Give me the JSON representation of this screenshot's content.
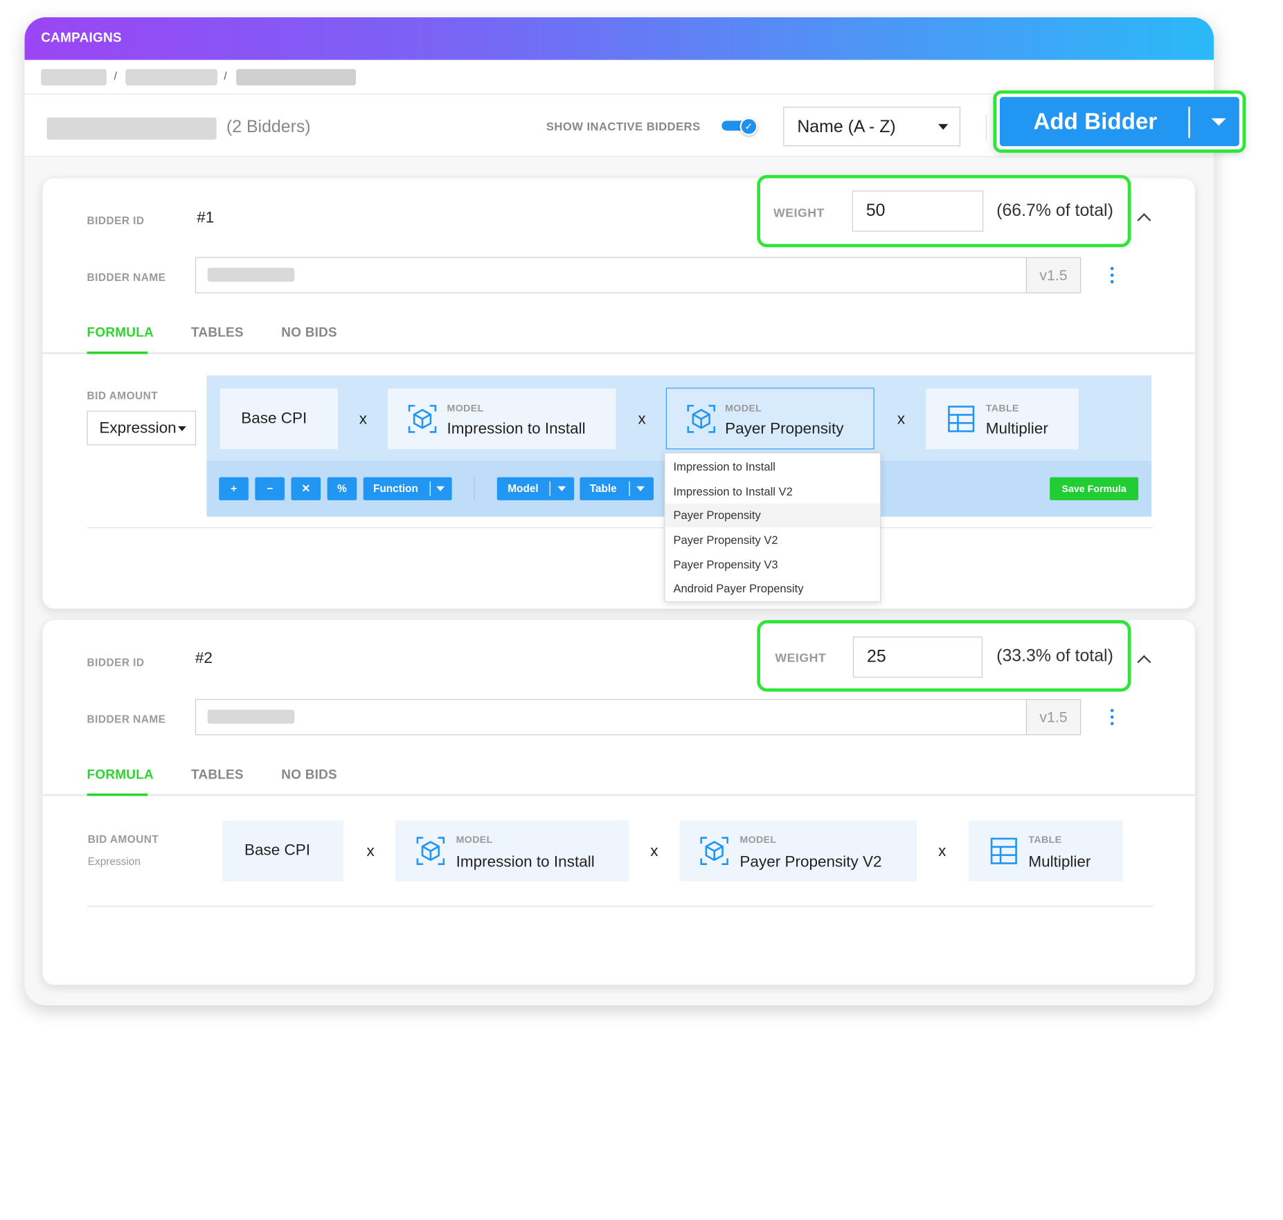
{
  "app": {
    "title": "CAMPAIGNS"
  },
  "header": {
    "bidders_count": "(2 Bidders)",
    "show_inactive_label": "SHOW INACTIVE BIDDERS",
    "show_inactive_on": true,
    "sort_value": "Name (A - Z)",
    "add_bidder_label": "Add Bidder"
  },
  "labels": {
    "bidder_id": "BIDDER ID",
    "bidder_name": "BIDDER NAME",
    "weight": "WEIGHT",
    "bid_amount": "BID AMOUNT",
    "model": "MODEL",
    "table": "TABLE",
    "x": "x"
  },
  "tabs": [
    "FORMULA",
    "TABLES",
    "NO BIDS"
  ],
  "bidders": [
    {
      "id": "#1",
      "weight": "50",
      "weight_pct": "(66.7% of total)",
      "version": "v1.5",
      "bid_amount_type": "Expression",
      "formula": {
        "base": "Base CPI",
        "model1": "Impression to Install",
        "model2": "Payer Propensity",
        "table": "Multiplier"
      }
    },
    {
      "id": "#2",
      "weight": "25",
      "weight_pct": "(33.3% of total)",
      "version": "v1.5",
      "bid_amount_type": "Expression",
      "formula": {
        "base": "Base CPI",
        "model1": "Impression to Install",
        "model2": "Payer Propensity V2",
        "table": "Multiplier"
      }
    }
  ],
  "toolbar": {
    "plus": "+",
    "minus": "−",
    "times": "✕",
    "percent": "%",
    "function": "Function",
    "model": "Model",
    "table": "Table",
    "save": "Save Formula"
  },
  "model_dropdown": {
    "items": [
      "Impression to Install",
      "Impression to Install V2",
      "Payer Propensity",
      "Payer Propensity V2",
      "Payer Propensity V3",
      "Android Payer Propensity"
    ],
    "highlighted": "Payer Propensity"
  },
  "colors": {
    "accent": "#2196f3",
    "highlight_green": "#2ee63a",
    "active_tab": "#2ed52e"
  }
}
